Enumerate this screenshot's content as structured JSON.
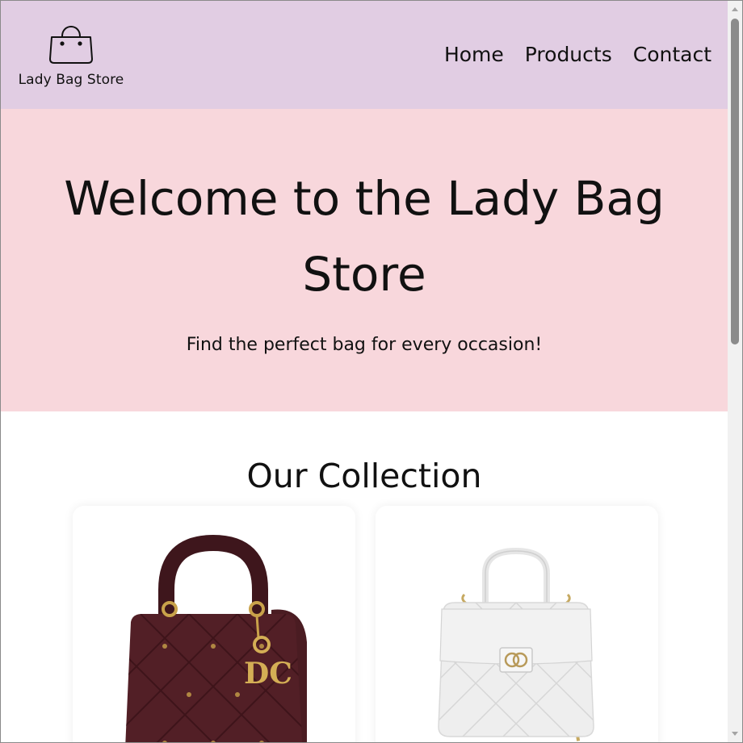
{
  "header": {
    "logo_text": "Lady Bag Store",
    "logo_icon": "handbag-icon",
    "background": "#e1cde3",
    "nav": [
      {
        "label": "Home"
      },
      {
        "label": "Products"
      },
      {
        "label": "Contact"
      }
    ]
  },
  "hero": {
    "title": "Welcome to the Lady Bag Store",
    "subtitle": "Find the perfect bag for every occasion!",
    "background": "#f8d7dc"
  },
  "collection": {
    "title": "Our Collection",
    "products": [
      {
        "image": "burgundy-quilted-handbag-image"
      },
      {
        "image": "white-quilted-flap-bag-image"
      }
    ]
  }
}
